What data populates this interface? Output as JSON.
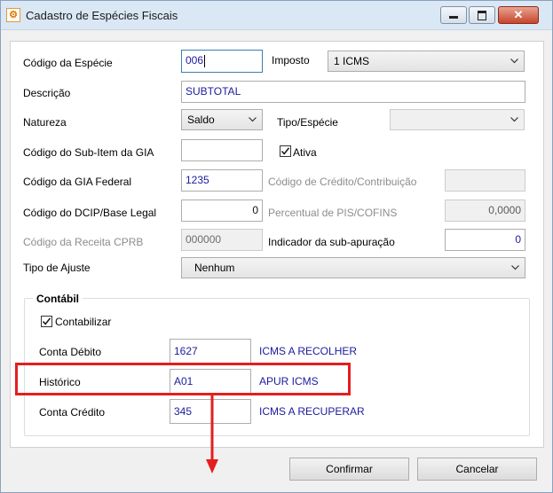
{
  "window": {
    "title": "Cadastro de Espécies Fiscais",
    "controls": {
      "minimize": "minimize",
      "maximize": "maximize",
      "close": "✕"
    }
  },
  "form": {
    "codigo_especie": {
      "label": "Código da Espécie",
      "value": "006"
    },
    "imposto": {
      "label": "Imposto",
      "value": "1 ICMS"
    },
    "descricao": {
      "label": "Descrição",
      "value": "SUBTOTAL"
    },
    "natureza": {
      "label": "Natureza",
      "value": "Saldo"
    },
    "tipo_especie": {
      "label": "Tipo/Espécie",
      "value": ""
    },
    "codigo_sub_item_gia": {
      "label": "Código do Sub-Item da GIA",
      "value": ""
    },
    "ativa": {
      "label": "Ativa",
      "checked": true
    },
    "codigo_gia_federal": {
      "label": "Código da GIA Federal",
      "value": "1235"
    },
    "codigo_credito_contribuicao": {
      "label": "Código de Crédito/Contribuição",
      "value": ""
    },
    "codigo_dcip": {
      "label": "Código do DCIP/Base Legal",
      "value": "0"
    },
    "percentual_pis_cofins": {
      "label": "Percentual de PIS/COFINS",
      "value": "0,0000"
    },
    "codigo_receita_cprb": {
      "label": "Código da Receita CPRB",
      "value": "000000"
    },
    "indicador_sub_apuracao": {
      "label": "Indicador da sub-apuração",
      "value": "0"
    },
    "tipo_ajuste": {
      "label": "Tipo de Ajuste",
      "value": "Nenhum"
    }
  },
  "contabil": {
    "title": "Contábil",
    "contabilizar": {
      "label": "Contabilizar",
      "checked": true
    },
    "conta_debito": {
      "label": "Conta Débito",
      "value": "1627",
      "description": "ICMS A RECOLHER"
    },
    "historico": {
      "label": "Histórico",
      "value": "A01",
      "description": "APUR ICMS"
    },
    "conta_credito": {
      "label": "Conta Crédito",
      "value": "345",
      "description": "ICMS A RECUPERAR"
    }
  },
  "buttons": {
    "confirmar": "Confirmar",
    "cancelar": "Cancelar"
  },
  "colors": {
    "highlight": "#e41e1e",
    "value_text": "#1b1b9e",
    "titlebar": "#dae7f5"
  },
  "icons": {
    "app": "app-icon",
    "chevron": "chevron-down-icon",
    "check": "check-icon",
    "arrow": "arrow-down-icon"
  }
}
